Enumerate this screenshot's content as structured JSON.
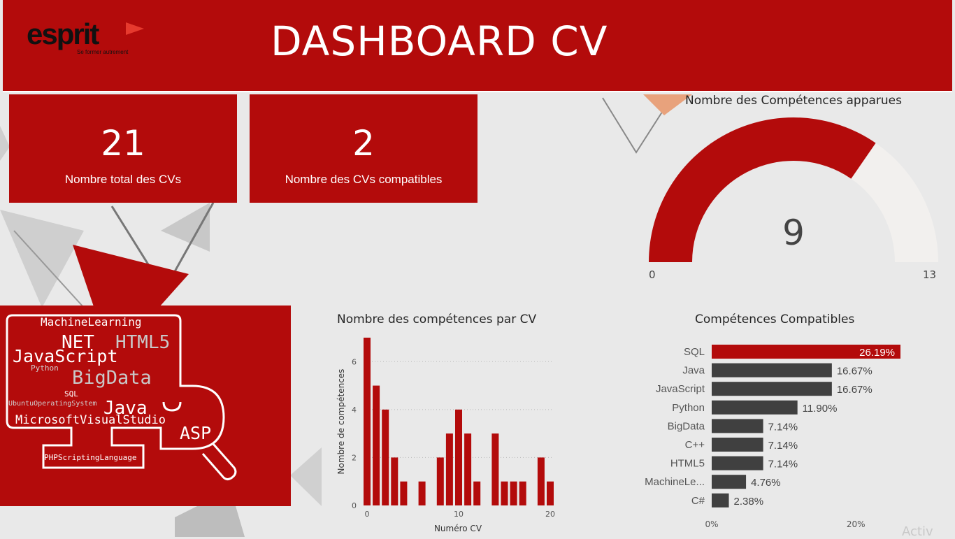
{
  "header": {
    "logo_text": "esprit",
    "logo_tagline": "Se former autrement",
    "title": "DASHBOARD CV"
  },
  "kpis": [
    {
      "value": "21",
      "label": "Nombre total des CVs"
    },
    {
      "value": "2",
      "label": "Nombre des CVs compatibles"
    }
  ],
  "gauge": {
    "title": "Nombre des Compétences apparues",
    "value": 9,
    "min": 0,
    "max": 13,
    "value_label": "9",
    "min_label": "0",
    "max_label": "13"
  },
  "wordcloud": {
    "words": [
      "MachineLearning",
      "NET",
      "HTML5",
      "JavaScript",
      "Python",
      "BigData",
      "SQL",
      "UbuntuOperatingSystem",
      "Java",
      "MicrosoftVisualStudio",
      "ASP",
      "PHPScriptingLanguage"
    ]
  },
  "chart_data": [
    {
      "type": "bar",
      "title": "Nombre des compétences par CV",
      "xlabel": "Numéro CV",
      "ylabel": "Nombre de compétences",
      "x": [
        0,
        1,
        2,
        3,
        4,
        5,
        6,
        7,
        8,
        9,
        10,
        11,
        12,
        13,
        14,
        15,
        16,
        17,
        18,
        19,
        20
      ],
      "values": [
        7,
        5,
        4,
        2,
        1,
        0,
        1,
        0,
        2,
        3,
        4,
        3,
        1,
        0,
        3,
        1,
        1,
        1,
        0,
        2,
        1
      ],
      "ylim": [
        0,
        7
      ],
      "yticks": [
        "0",
        "2",
        "4",
        "6"
      ],
      "xticks": [
        "0",
        "10",
        "20"
      ],
      "grid": true,
      "color": "#b30b0b"
    },
    {
      "type": "bar",
      "orientation": "horizontal",
      "title": "Compétences Compatibles",
      "categories": [
        "SQL",
        "Java",
        "JavaScript",
        "Python",
        "BigData",
        "C++",
        "HTML5",
        "MachineLe...",
        "C#"
      ],
      "values": [
        26.19,
        16.67,
        16.67,
        11.9,
        7.14,
        7.14,
        7.14,
        4.76,
        2.38
      ],
      "value_labels": [
        "26.19%",
        "16.67%",
        "16.67%",
        "11.90%",
        "7.14%",
        "7.14%",
        "7.14%",
        "4.76%",
        "2.38%"
      ],
      "xticks": [
        "0%",
        "20%"
      ],
      "xlim": [
        0,
        26.19
      ],
      "highlight_color": "#b30b0b",
      "color": "#404040"
    }
  ],
  "watermark": "Activ",
  "colors": {
    "brand": "#b30b0b",
    "dark_bar": "#404040",
    "gauge_track": "#f2f0ee"
  }
}
